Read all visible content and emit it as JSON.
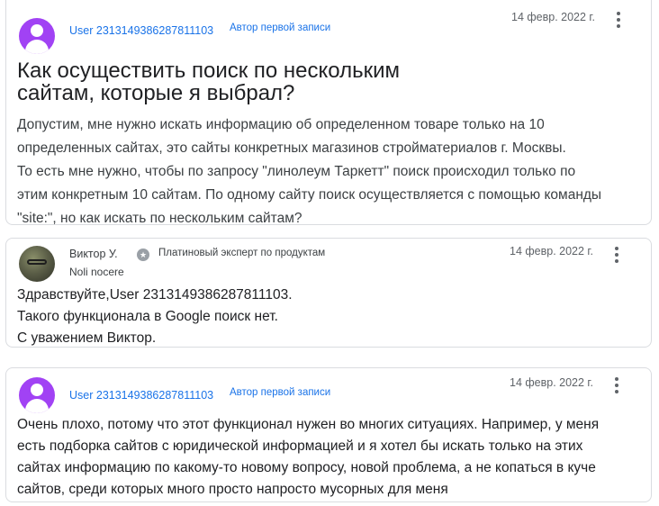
{
  "question": {
    "author": "User 2313149386287811103",
    "badge": "Автор первой записи",
    "date": "14 февр. 2022 г.",
    "title_lines": [
      "Как осуществить поиск по нескольким",
      "сайтам, которые я выбрал?"
    ],
    "body_lines": [
      "Допустим, мне нужно искать информацию об определенном товаре только на 10",
      "определенных сайтах, это сайты конкретных магазинов стройматериалов г. Москвы.",
      "То есть мне нужно, чтобы по запросу \"линолеум Таркетт\" поиск происходил только по",
      "этим конкретным 10 сайтам. По одному сайту поиск осуществляется с помощью команды",
      "\"site:\", но как искать по нескольким сайтам?"
    ]
  },
  "reply1": {
    "author": "Виктор У.",
    "expert_label": "Платиновый эксперт по продуктам",
    "subtitle": "Noli nocere",
    "date": "14 февр. 2022 г.",
    "body_lines": [
      "Здравствуйте,User 2313149386287811103.",
      "Такого функционала в Google поиск нет.",
      "С уважением Виктор."
    ]
  },
  "reply2": {
    "author": "User 2313149386287811103",
    "badge": "Автор первой записи",
    "date": "14 февр. 2022 г.",
    "body_lines": [
      "Очень плохо, потому что этот функционал нужен во многих ситуациях. Например, у меня",
      "есть подборка сайтов с юридической информацией и я хотел бы искать только на этих",
      "сайтах информацию по какому-то новому вопросу, новой проблема, а не копаться в куче",
      "сайтов, среди которых много просто напросто мусорных для меня"
    ]
  },
  "icons": {
    "avatar_generic": "account-circle-icon",
    "expert": "platinum-expert-badge-icon",
    "menu": "more-vert-icon"
  },
  "colors": {
    "link": "#1a73e8",
    "avatar": "#a142f4",
    "border": "#dadce0"
  }
}
